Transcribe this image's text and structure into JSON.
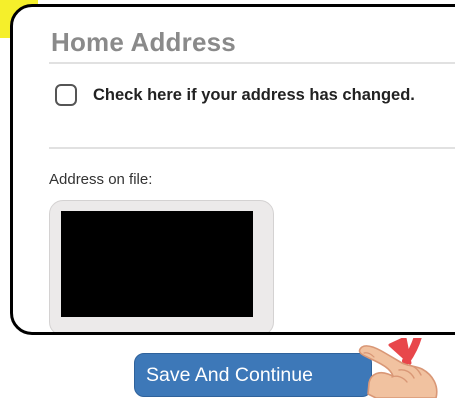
{
  "form": {
    "section_title": "Home Address",
    "checkbox": {
      "label": "Check here if your address has changed.",
      "checked": false
    },
    "address_on_file_label": "Address on file:",
    "address_value_visible": false
  },
  "actions": {
    "save_label": "Save And Continue"
  },
  "overlay": {
    "pointer_icon": "hand-pointer-icon",
    "arrow_icon": "curved-arrow-icon",
    "arrow_color": "#e8474b",
    "highlight_color": "#f5ef2b"
  },
  "colors": {
    "button_background": "#3d78b8",
    "panel_border": "#000000",
    "title_text": "#8a8a8a"
  }
}
